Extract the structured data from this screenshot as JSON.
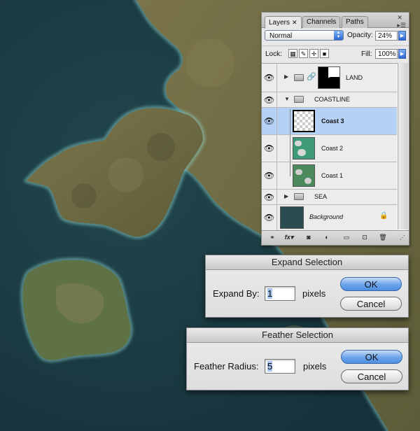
{
  "layers_panel": {
    "tabs": [
      {
        "label": "Layers",
        "close": "✕"
      },
      {
        "label": "Channels"
      },
      {
        "label": "Paths"
      }
    ],
    "blend_mode": "Normal",
    "opacity_label": "Opacity:",
    "opacity_value": "24%",
    "lock_label": "Lock:",
    "fill_label": "Fill:",
    "fill_value": "100%",
    "layers": [
      {
        "name": "LAND",
        "type": "group",
        "visible": true,
        "collapsed": true
      },
      {
        "name": "COASTLINE",
        "type": "group",
        "visible": true,
        "collapsed": false
      },
      {
        "name": "Coast 3",
        "type": "layer",
        "visible": true,
        "selected": true
      },
      {
        "name": "Coast 2",
        "type": "layer",
        "visible": true
      },
      {
        "name": "Coast 1",
        "type": "layer",
        "visible": true
      },
      {
        "name": "SEA",
        "type": "group",
        "visible": true,
        "collapsed": true
      },
      {
        "name": "Background",
        "type": "background",
        "visible": true,
        "locked": true
      }
    ],
    "fx_label": "fx"
  },
  "expand_dialog": {
    "title": "Expand Selection",
    "label": "Expand By:",
    "value": "1",
    "unit": "pixels",
    "ok": "OK",
    "cancel": "Cancel"
  },
  "feather_dialog": {
    "title": "Feather Selection",
    "label": "Feather Radius:",
    "value": "5",
    "unit": "pixels",
    "ok": "OK",
    "cancel": "Cancel"
  },
  "colors": {
    "sea": "#1e3e45",
    "land": "#6f6a45",
    "coast_glow": "#8fd6cf",
    "selection": "#b5d1f6",
    "aqua_button": "#4f8fe3"
  }
}
